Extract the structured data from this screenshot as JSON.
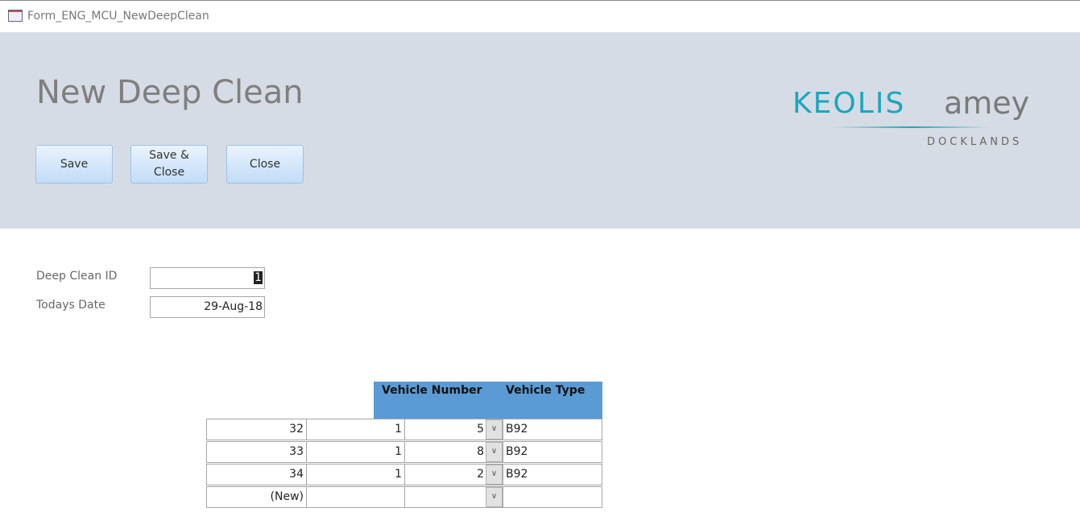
{
  "window": {
    "title": "Form_ENG_MCU_NewDeepClean"
  },
  "header": {
    "title": "New Deep Clean",
    "buttons": {
      "save": "Save",
      "save_close": "Save & Close",
      "close": "Close"
    },
    "logo": {
      "keolis": "KEOLIS",
      "amey": "amey",
      "docklands": "DOCKLANDS",
      "teal": "#1aa7be",
      "gray": "#7a7a7a"
    }
  },
  "fields": {
    "deep_clean_id": {
      "label": "Deep Clean ID",
      "value": "1"
    },
    "todays_date": {
      "label": "Todays Date",
      "value": "29-Aug-18"
    }
  },
  "grid": {
    "headers": {
      "vehicle_number": "Vehicle Number",
      "vehicle_type": "Vehicle Type"
    },
    "rows": [
      {
        "id": "32",
        "c2": "1",
        "vehicle_number": "5",
        "vehicle_type": "B92"
      },
      {
        "id": "33",
        "c2": "1",
        "vehicle_number": "8",
        "vehicle_type": "B92"
      },
      {
        "id": "34",
        "c2": "1",
        "vehicle_number": "2",
        "vehicle_type": "B92"
      },
      {
        "id": "(New)",
        "c2": "",
        "vehicle_number": "",
        "vehicle_type": ""
      }
    ]
  }
}
